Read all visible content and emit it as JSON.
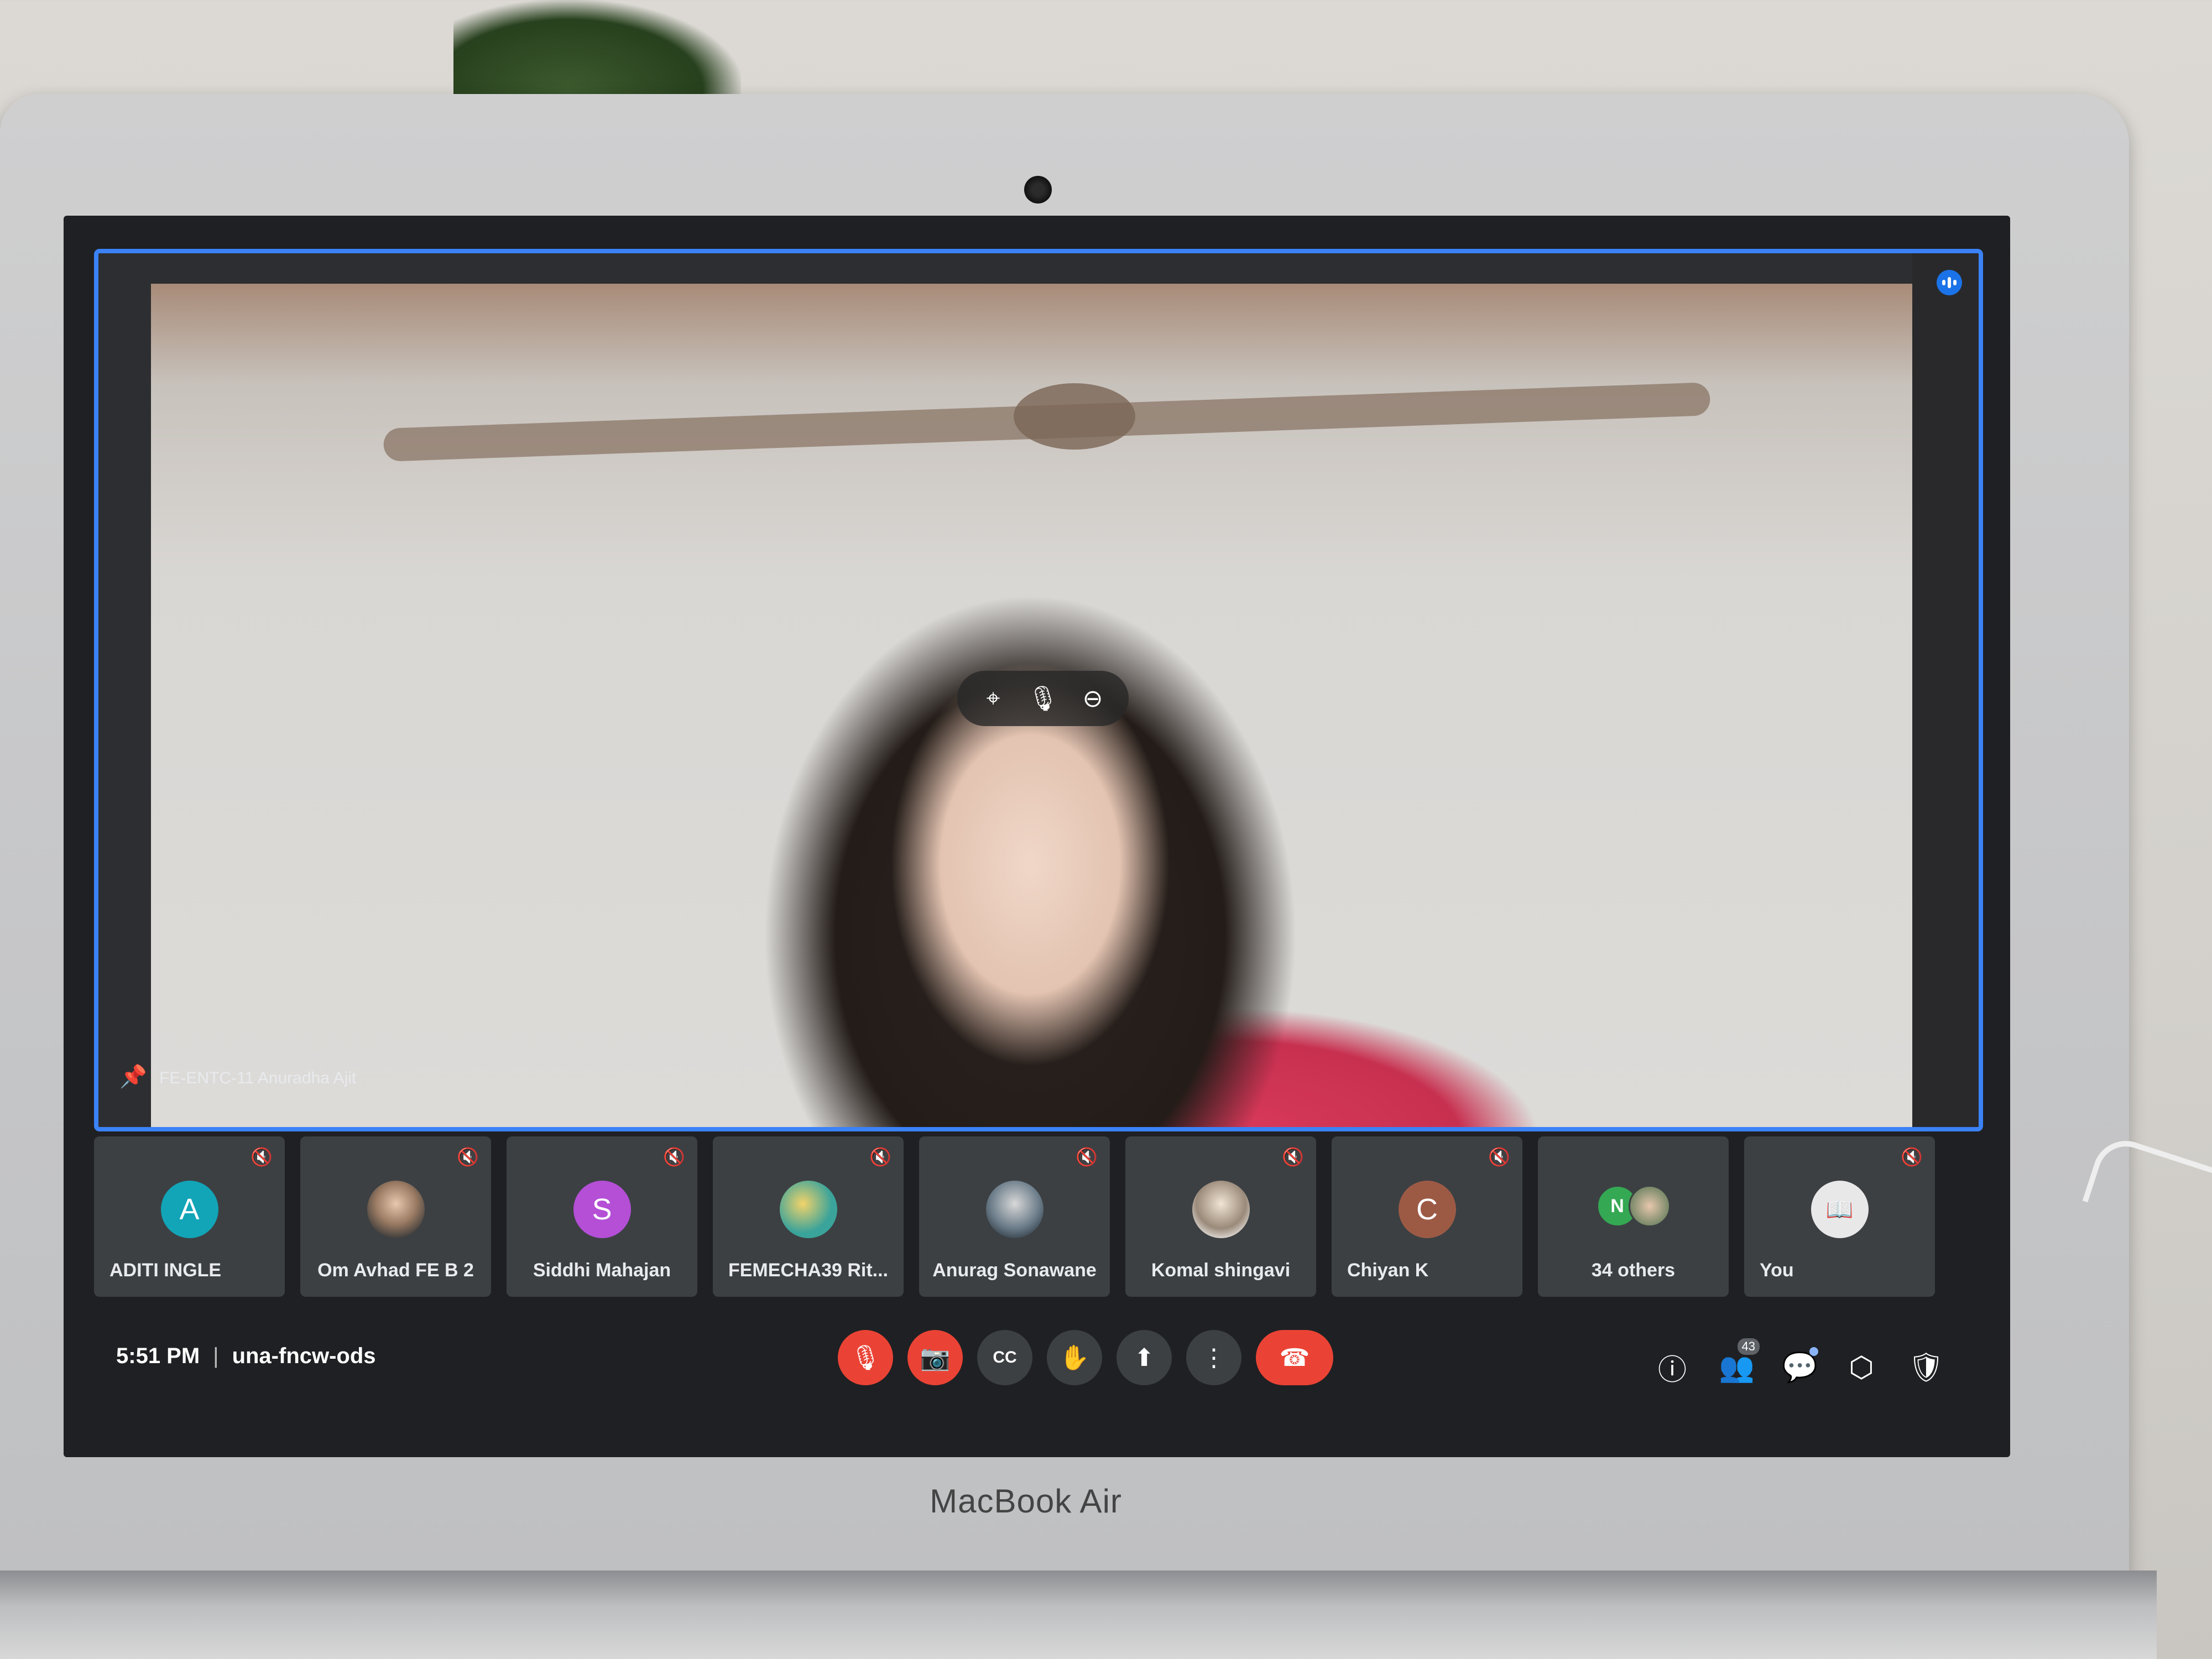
{
  "device": {
    "brand_label": "MacBook Air"
  },
  "main_tile": {
    "participant_name": "FE-ENTC-11 Anuradha Ajit",
    "hover_controls": [
      "unpin-icon",
      "mic-icon",
      "remove-icon"
    ]
  },
  "participants": [
    {
      "name": "ADITI INGLE",
      "initial": "A",
      "avatar_color": "#12a4b7",
      "muted": true
    },
    {
      "name": "Om Avhad FE B 2",
      "initial": "",
      "avatar_color": "#8a6a55",
      "muted": true
    },
    {
      "name": "Siddhi Mahajan",
      "initial": "S",
      "avatar_color": "#b44fd6",
      "muted": true
    },
    {
      "name": "FEMECHA39 Rit...",
      "initial": "",
      "avatar_color": "#3aa39a",
      "muted": true
    },
    {
      "name": "Anurag Sonawane",
      "initial": "",
      "avatar_color": "#6b7c89",
      "muted": true
    },
    {
      "name": "Komal shingavi",
      "initial": "",
      "avatar_color": "#9a8a7a",
      "muted": true
    },
    {
      "name": "Chiyan K",
      "initial": "C",
      "avatar_color": "#9c5a45",
      "muted": true
    }
  ],
  "others_tile": {
    "label": "34 others",
    "mini_initial": "N",
    "mini_color": "#34a853"
  },
  "self_tile": {
    "label": "You",
    "muted": true
  },
  "bottom_bar": {
    "time": "5:51 PM",
    "meeting_code": "una-fncw-ods",
    "people_count": "43"
  },
  "colors": {
    "accent": "#3b82f6",
    "danger": "#ea4335",
    "tile_bg": "#3c4043"
  }
}
